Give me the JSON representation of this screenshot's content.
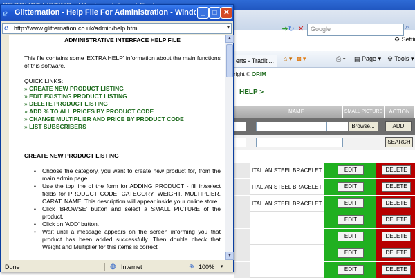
{
  "browser": {
    "title": "PRODUCT LISTING - Windows Internet Explorer",
    "search_placeholder": "Google",
    "settings_label": "Setting",
    "tab_label": "erts - Traditi...",
    "page_menu": "Page",
    "tools_menu": "Tools"
  },
  "main_page": {
    "copyright": "right ©",
    "copyright_brand": "ORIM",
    "help_link": "HELP >",
    "table": {
      "headers": {
        "name": "NAME",
        "small_picture": "SMALL PICTURE",
        "action": "ACTION"
      },
      "browse_label": "Browse...",
      "add_label": "ADD",
      "search_label": "SEARCH",
      "rows": [
        {
          "name": "ITALIAN STEEL BRACELET",
          "edit": "EDIT",
          "delete": "DELETE"
        },
        {
          "name": "ITALIAN STEEL BRACELET",
          "edit": "EDIT",
          "delete": "DELETE"
        },
        {
          "name": "ITALIAN STEEL BRACELET",
          "edit": "EDIT",
          "delete": "DELETE"
        },
        {
          "name": "",
          "edit": "EDIT",
          "delete": "DELETE"
        },
        {
          "name": "",
          "edit": "EDIT",
          "delete": "DELETE"
        },
        {
          "name": "",
          "edit": "EDIT",
          "delete": "DELETE"
        },
        {
          "name": "",
          "edit": "EDIT",
          "delete": "DELETE"
        }
      ]
    }
  },
  "popup": {
    "title": "Glitternation - Help File For Administration - Windows I...",
    "url": "http://www.glitternation.co.uk/admin/help.htm",
    "heading": "ADMINISTRATIVE INTERFACE HELP FILE",
    "intro": "This file contains some 'EXTRA HELP' information about the main functions of this software.",
    "quick_links_label": "QUICK LINKS:",
    "quick_links": [
      "CREATE NEW PRODUCT LISTING",
      "EDIT EXISTING PRODUCT LISTING",
      "DELETE PRODUCT LISTING",
      "ADD % TO ALL PRICES BY PRODUCT CODE",
      "CHANGE MULTIPLIER AND PRICE BY PRODUCT CODE",
      "LIST SUBSCRIBERS"
    ],
    "section_title": "CREATE NEW PRODUCT LISTING",
    "instructions": [
      "Choose the category, you want to create new product for, from the main admin page.",
      "Use the top line of the form for ADDING PRODUCT - fill in/select fields for PRODUCT CODE, CATEGORY, WEIGHT, MULTIPLIER, CARAT, NAME. This description will appear inside your online store.",
      "Click 'BROWSE' button and select a SMALL PICTURE of the product.",
      "Click on 'ADD' button.",
      "Wait until a message appears on the screen informing you that product has been added successfully. Then double check that Weight and Multiplier for this items is correct"
    ],
    "status": {
      "left": "Done",
      "zone": "Internet",
      "zoom": "100%"
    }
  }
}
